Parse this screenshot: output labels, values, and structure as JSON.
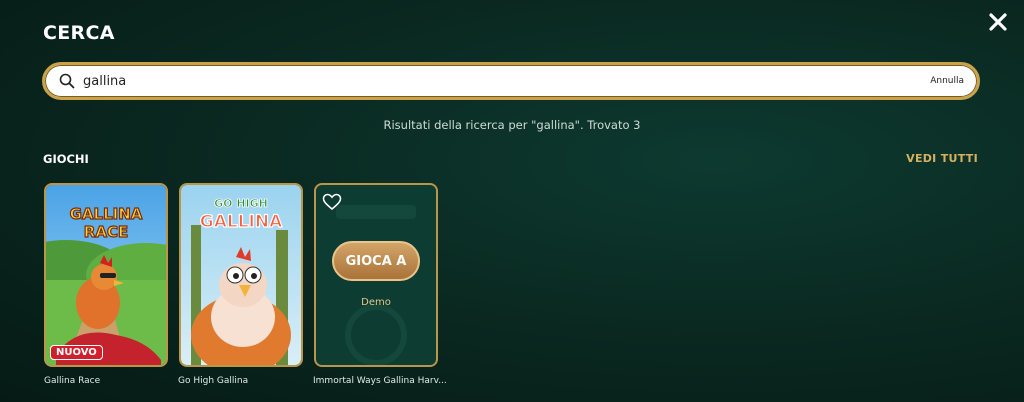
{
  "header": {
    "title": "CERCA"
  },
  "search": {
    "value": "gallina",
    "cancel_label": "Annulla"
  },
  "results": {
    "summary": "Risultati della ricerca per \"gallina\". Trovato 3"
  },
  "games_section": {
    "title": "GIOCHI",
    "see_all_label": "VEDI TUTTI",
    "items": [
      {
        "name": "Gallina Race",
        "logo_line1": "GALLINA",
        "logo_line2": "RACE",
        "badge": "NUOVO"
      },
      {
        "name": "Go High Gallina",
        "logo_line1": "GO HIGH",
        "logo_line2": "GALLINA"
      },
      {
        "name": "Immortal Ways Gallina Harv...",
        "play_label": "GIOCA A",
        "demo_label": "Demo"
      }
    ]
  },
  "colors": {
    "accent_gold": "#c9a24a",
    "background": "#0a2a22",
    "badge_red": "#d0202b"
  }
}
